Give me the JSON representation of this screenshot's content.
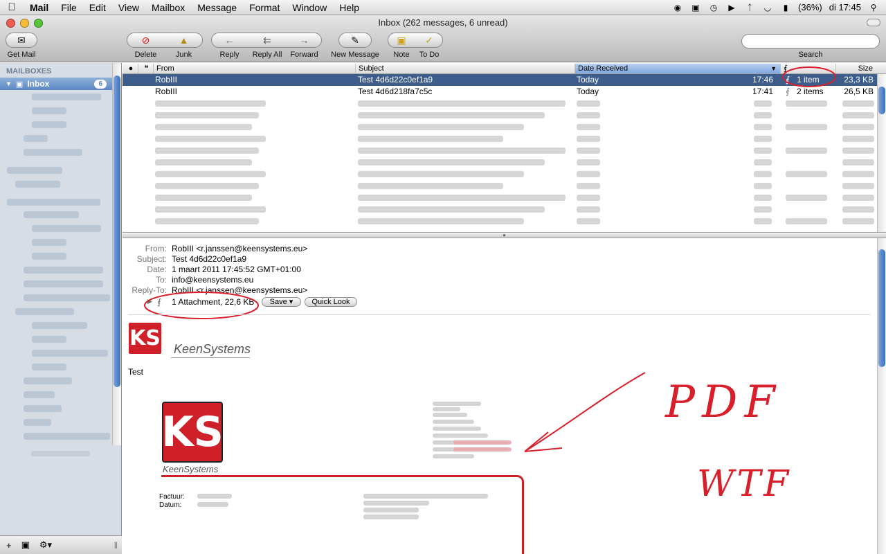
{
  "menubar": {
    "app": "Mail",
    "items": [
      "File",
      "Edit",
      "View",
      "Mailbox",
      "Message",
      "Format",
      "Window",
      "Help"
    ],
    "battery": "(36%)",
    "clock": "di 17:45",
    "status_icons": [
      "binoculars-icon",
      "sync-icon",
      "time-machine-icon",
      "volume-icon",
      "bluetooth-icon",
      "wifi-icon",
      "battery-icon",
      "spotlight-icon"
    ]
  },
  "window": {
    "title": "Inbox (262 messages, 6 unread)",
    "lights": {
      "close": "#ee5b50",
      "minimize": "#f5bd3a",
      "zoom": "#56c43d"
    }
  },
  "toolbar": {
    "get_mail": "Get Mail",
    "delete": "Delete",
    "junk": "Junk",
    "reply": "Reply",
    "reply_all": "Reply All",
    "forward": "Forward",
    "new_message": "New Message",
    "note": "Note",
    "todo": "To Do",
    "search_label": "Search",
    "search_value": ""
  },
  "sidebar": {
    "heading": "MAILBOXES",
    "inbox_label": "Inbox",
    "inbox_unread": "6",
    "selection_color": "#5b88c4"
  },
  "list": {
    "columns": {
      "from": "From",
      "subject": "Subject",
      "date": "Date Received",
      "size": "Size"
    },
    "rows": [
      {
        "from": "RobIII",
        "subject": "Test 4d6d22c0ef1a9",
        "date": "Today",
        "time": "17:46",
        "attachments": "1 item",
        "size": "23,3 KB",
        "selected": true
      },
      {
        "from": "RobIII",
        "subject": "Test 4d6d218fa7c5c",
        "date": "Today",
        "time": "17:41",
        "attachments": "2 items",
        "size": "26,5 KB",
        "selected": false
      }
    ]
  },
  "message": {
    "labels": {
      "from": "From:",
      "subject": "Subject:",
      "date": "Date:",
      "to": "To:",
      "reply_to": "Reply-To:"
    },
    "from": "RobIII <r.janssen@keensystems.eu>",
    "subject": "Test 4d6d22c0ef1a9",
    "date": "1 maart 2011 17:45:52 GMT+01:00",
    "to": "info@keensystems.eu",
    "reply_to": "RobIII <r.janssen@keensystems.eu>",
    "attachment": "1 Attachment, 22,6 KB",
    "save_label": "Save",
    "quicklook_label": "Quick Look",
    "logo_text": "KS",
    "brand": "KeenSystems",
    "body": "Test",
    "invoice_label": "Factuur:",
    "date_label": "Datum:",
    "annotations": {
      "pdf": "PDF",
      "wtf": "WTF",
      "color": "#d81f2a"
    }
  }
}
